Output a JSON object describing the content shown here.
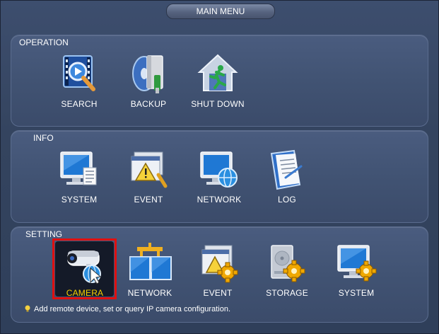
{
  "window": {
    "title": "MAIN MENU"
  },
  "sections": {
    "operation": {
      "label": "OPERATION",
      "items": [
        {
          "label": "SEARCH",
          "icon": "search-icon"
        },
        {
          "label": "BACKUP",
          "icon": "backup-icon"
        },
        {
          "label": "SHUT DOWN",
          "icon": "shutdown-icon"
        }
      ]
    },
    "info": {
      "label": "INFO",
      "items": [
        {
          "label": "SYSTEM",
          "icon": "system-info-icon"
        },
        {
          "label": "EVENT",
          "icon": "event-info-icon"
        },
        {
          "label": "NETWORK",
          "icon": "network-info-icon"
        },
        {
          "label": "LOG",
          "icon": "log-icon"
        }
      ]
    },
    "setting": {
      "label": "SETTING",
      "items": [
        {
          "label": "CAMERA",
          "icon": "camera-icon",
          "selected": true
        },
        {
          "label": "NETWORK",
          "icon": "network-setting-icon"
        },
        {
          "label": "EVENT",
          "icon": "event-setting-icon"
        },
        {
          "label": "STORAGE",
          "icon": "storage-setting-icon"
        },
        {
          "label": "SYSTEM",
          "icon": "system-setting-icon"
        }
      ]
    }
  },
  "hint": "Add remote device, set or query IP camera configuration.",
  "colors": {
    "highlight": "#e01010",
    "selected_label": "#f5d000",
    "gear": "#f0a800"
  }
}
